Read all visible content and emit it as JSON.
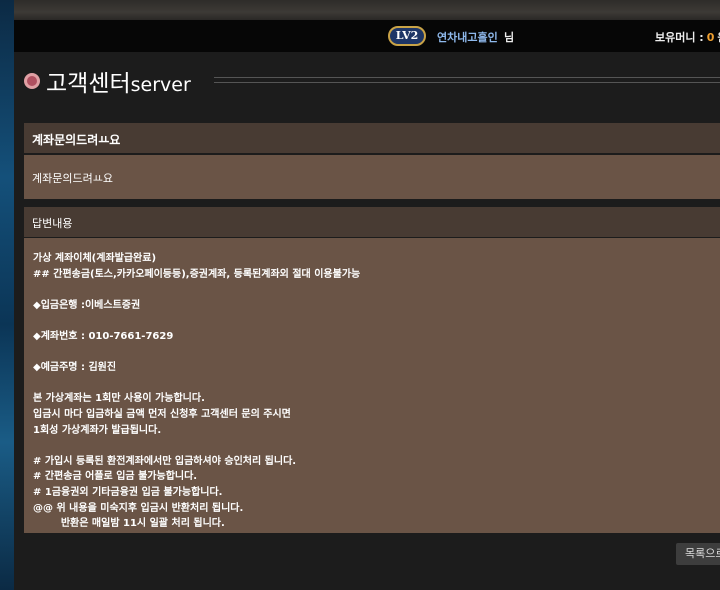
{
  "user_bar": {
    "level": "LV2",
    "username": "연차내고홀인",
    "suffix": "님",
    "money_label": "보유머니 :",
    "money_amount": "0",
    "money_unit": "원"
  },
  "page": {
    "title": "고객센터",
    "title_suffix": "server"
  },
  "inquiry": {
    "subject": "계좌문의드려ㅛ요",
    "content": "계좌문의드려ㅛ요"
  },
  "answer": {
    "header": "답변내용",
    "body": "가상 계좌이체(계좌발급완료)\n## 간편송금(토스,카카오페이등등),증권계좌, 등록된계좌외 절대 이용불가능\n\n◆입금은행 :이베스트증권\n\n◆계좌번호 : 010-7661-7629\n\n◆예금주명 : 김원진\n\n본 가상계좌는 1회만 사용이 가능합니다.\n입금시 마다 입금하실 금액 먼저 신청후 고객센터 문의 주시면\n1회성 가상계좌가 발급됩니다.\n\n# 가입시 등록된 환전계좌에서만 입금하셔야 승인처리 됩니다.\n# 간편송금 어플로 입금 불가능합니다.\n# 1금융권외 기타금융권 입금 불가능합니다.\n@@ 위 내용을 미숙지후 입금시 반환처리 됩니다.\n        반환은 매일밤 11시 일괄 처리 됩니다."
  },
  "buttons": {
    "list": "목록으로"
  }
}
